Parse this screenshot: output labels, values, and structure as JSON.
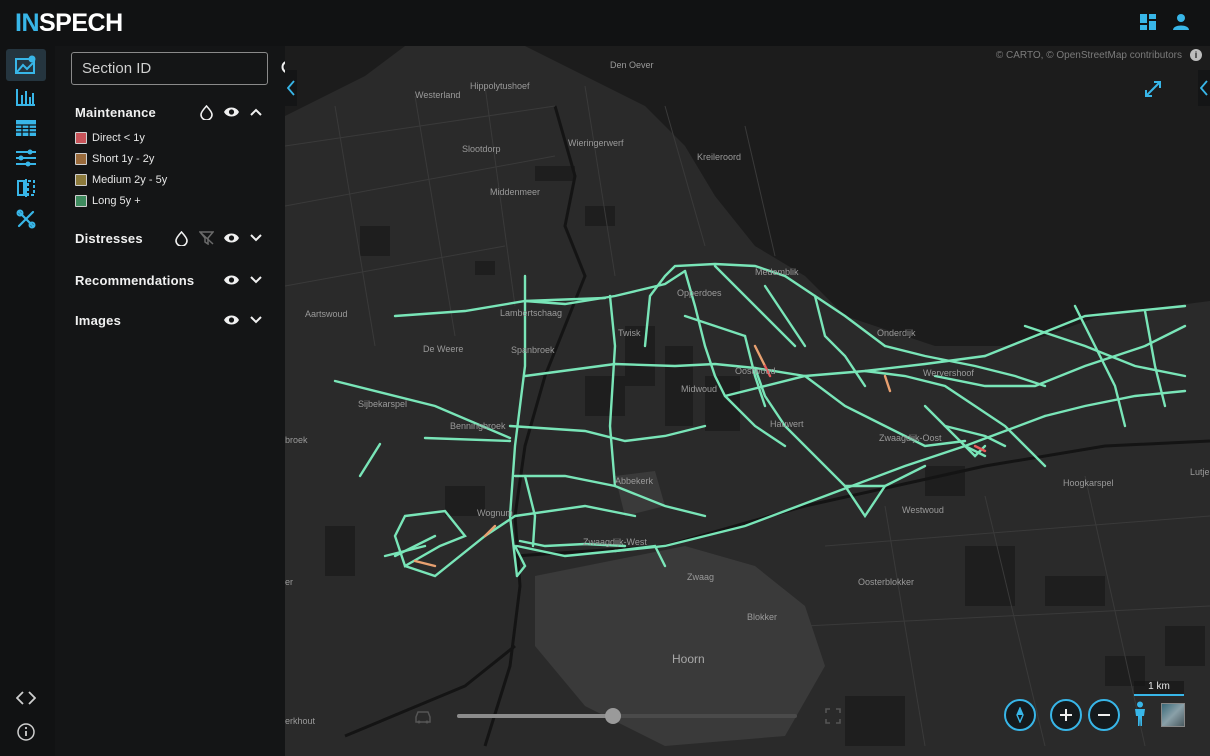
{
  "app": {
    "logo_part1": "IN",
    "logo_part2": "SPECH",
    "accent": "#38b6e8"
  },
  "top_icons": [
    "dashboard-icon",
    "user-icon"
  ],
  "rail": {
    "items": [
      "map-icon",
      "bar-chart-icon",
      "table-icon",
      "sliders-icon",
      "compare-icon",
      "tools-icon"
    ],
    "bottom": [
      "code-icon",
      "info-icon"
    ]
  },
  "search": {
    "placeholder": "Section ID"
  },
  "layers": {
    "maintenance": {
      "title": "Maintenance",
      "expanded": true,
      "legend": [
        {
          "label": "Direct < 1y",
          "color": "#c8545a"
        },
        {
          "label": "Short 1y - 2y",
          "color": "#9a6b3c"
        },
        {
          "label": "Medium 2y - 5y",
          "color": "#8c7a3c"
        },
        {
          "label": "Long 5y +",
          "color": "#3e8a5e"
        }
      ]
    },
    "distresses": {
      "title": "Distresses",
      "expanded": false
    },
    "recommendations": {
      "title": "Recommendations",
      "expanded": false
    },
    "images": {
      "title": "Images",
      "expanded": false
    }
  },
  "map": {
    "attribution": "© CARTO, © OpenStreetMap contributors",
    "scale_label": "1 km",
    "slider_fraction": 0.46,
    "road_color": "#7ef0c0",
    "places": {
      "den_oever": "Den Oever",
      "hippolytushoef": "Hippolytushoef",
      "westerland": "Westerland",
      "slootdorp": "Slootdorp",
      "wieringerwerf": "Wieringerwerf",
      "kreileroord": "Kreileroord",
      "middenmeer": "Middenmeer",
      "medemblik": "Medemblik",
      "opperdoes": "Opperdoes",
      "lambertschaag": "Lambertschaag",
      "twisk": "Twisk",
      "aartswoud": "Aartswoud",
      "de_weere": "De Weere",
      "spanbroek": "Spanbroek",
      "onderdijk": "Onderdijk",
      "oostwoud": "Oostwoud",
      "midwoud": "Midwoud",
      "wervershoof": "Wervershoof",
      "sijbekarspel": "Sijbekarspel",
      "benningbroek": "Benningbroek",
      "hauwert": "Hauwert",
      "zwaagdijk_oost": "Zwaagdijk-Oost",
      "broek": "broek",
      "abbekerk": "Abbekerk",
      "wognum": "Wognum",
      "zwaagdijk_west": "Zwaagdijk-West",
      "lutjebroek": "Lutjeb",
      "hoogkarspel": "Hoogkarspel",
      "westwoud": "Westwoud",
      "zwaag": "Zwaag",
      "oosterblokker": "Oosterblokker",
      "blokker": "Blokker",
      "hoorn": "Hoorn",
      "er": "er",
      "avenhorn": "erkhout"
    }
  }
}
